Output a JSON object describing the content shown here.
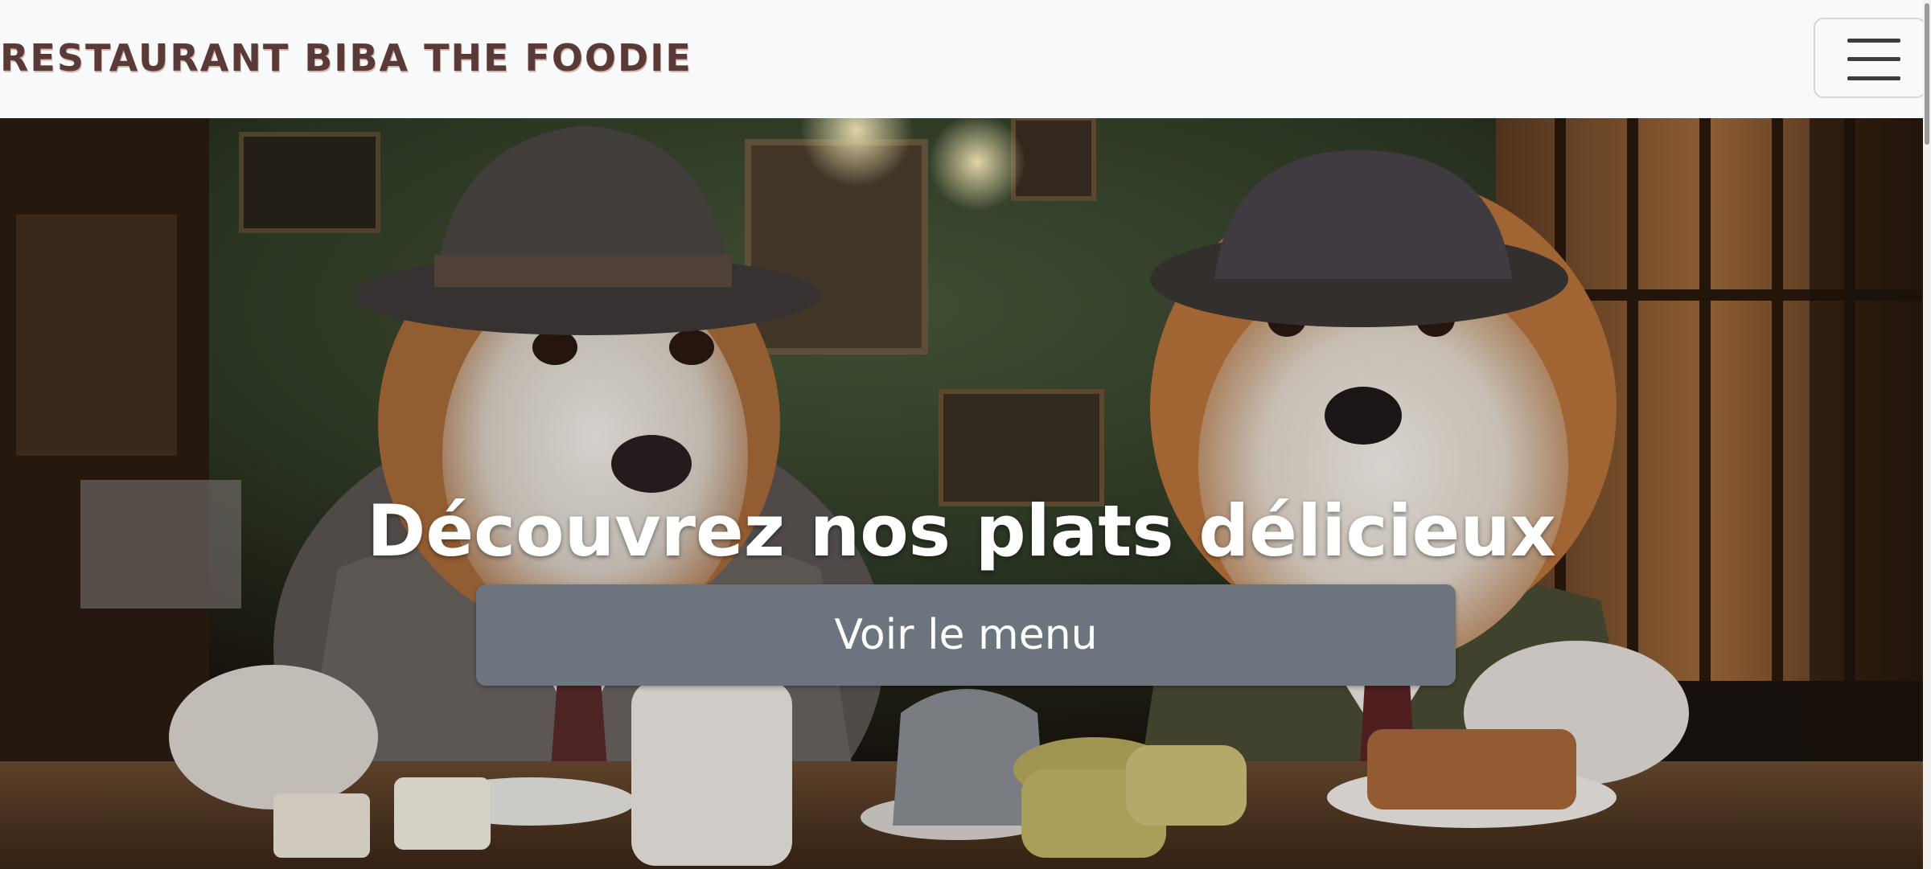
{
  "navbar": {
    "brand": "RESTAURANT BIBA THE FOODIE",
    "toggler_icon": "hamburger-menu-icon"
  },
  "hero": {
    "image_description": "two-dogs-in-hats-dining-photo",
    "title": "Découvrez nos plats délicieux",
    "button_label": "Voir le menu"
  },
  "colors": {
    "brand_text": "#5a3a36",
    "navbar_bg": "#f8f9fa",
    "button_bg": "#6c757d",
    "hero_text": "#ffffff"
  }
}
